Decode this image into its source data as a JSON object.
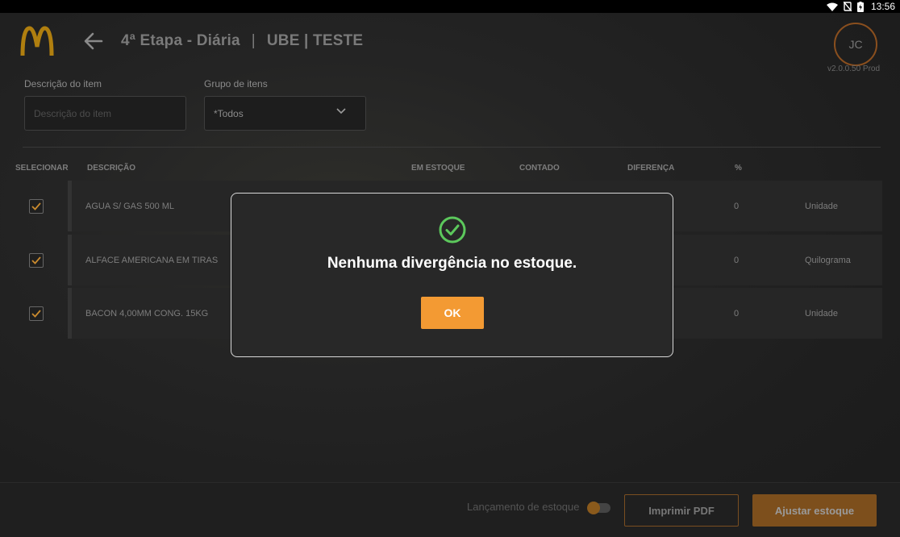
{
  "status_bar": {
    "time": "13:56"
  },
  "header": {
    "title_left": "4ª Etapa - Diária",
    "separator": "|",
    "title_right": "UBE | TESTE",
    "avatar_initials": "JC",
    "version": "v2.0.0.50 Prod"
  },
  "filters": {
    "description_label": "Descrição do item",
    "description_placeholder": "Descrição do item",
    "group_label": "Grupo de itens",
    "group_value": "*Todos"
  },
  "table": {
    "headers": {
      "select": "SELECIONAR",
      "description": "DESCRIÇÃO",
      "in_stock": "EM ESTOQUE",
      "counted": "CONTADO",
      "difference": "DIFERENÇA",
      "percent": "%"
    },
    "rows": [
      {
        "description": "AGUA S/ GAS 500 ML",
        "percent": "0",
        "unit": "Unidade",
        "checked": true
      },
      {
        "description": "ALFACE AMERICANA EM TIRAS",
        "percent": "0",
        "unit": "Quilograma",
        "checked": true
      },
      {
        "description": "BACON 4,00MM CONG. 15KG",
        "percent": "0",
        "unit": "Unidade",
        "checked": true
      }
    ]
  },
  "footer": {
    "toggle_label": "Lançamento de estoque",
    "print_button": "Imprimir PDF",
    "adjust_button": "Ajustar estoque"
  },
  "dialog": {
    "message": "Nenhuma divergência no estoque.",
    "ok_button": "OK",
    "icon": "check-circle-icon"
  },
  "colors": {
    "accent": "#f39a33",
    "success": "#5cc85c",
    "logo": "#b07f0f"
  }
}
